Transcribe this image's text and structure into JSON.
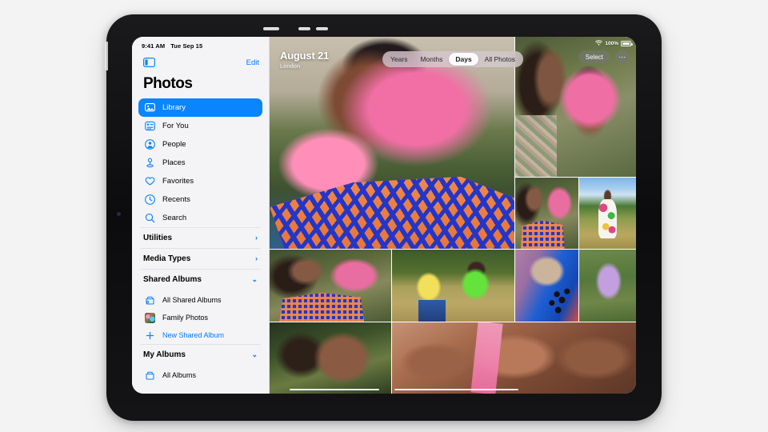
{
  "device": {
    "name": "iPad Pro",
    "frame_color": "#111113"
  },
  "status_bar": {
    "time": "9:41 AM",
    "date": "Tue Sep 15",
    "wifi_icon": "wifi-icon",
    "battery_percent": "100%",
    "battery_icon": "battery-full-icon"
  },
  "sidebar": {
    "toggle_icon": "sidebar-toggle-icon",
    "edit_label": "Edit",
    "title": "Photos",
    "nav_items": [
      {
        "label": "Library",
        "icon": "photos-library-icon",
        "selected": true
      },
      {
        "label": "For You",
        "icon": "for-you-icon",
        "selected": false
      },
      {
        "label": "People",
        "icon": "person-circle-icon",
        "selected": false
      },
      {
        "label": "Places",
        "icon": "map-pin-icon",
        "selected": false
      },
      {
        "label": "Favorites",
        "icon": "heart-icon",
        "selected": false
      },
      {
        "label": "Recents",
        "icon": "clock-icon",
        "selected": false
      },
      {
        "label": "Search",
        "icon": "search-icon",
        "selected": false
      }
    ],
    "sections": [
      {
        "label": "Utilities",
        "chevron": "chevron-right-icon",
        "expanded": false,
        "items": []
      },
      {
        "label": "Media Types",
        "chevron": "chevron-right-icon",
        "expanded": false,
        "items": []
      },
      {
        "label": "Shared Albums",
        "chevron": "chevron-down-icon",
        "expanded": true,
        "items": [
          {
            "label": "All Shared Albums",
            "icon": "shared-album-icon",
            "accent": false
          },
          {
            "label": "Family Photos",
            "icon": "album-thumbnail",
            "accent": false
          },
          {
            "label": "New Shared Album",
            "icon": "plus-icon",
            "accent": true
          }
        ]
      },
      {
        "label": "My Albums",
        "chevron": "chevron-down-icon",
        "expanded": true,
        "items": [
          {
            "label": "All Albums",
            "icon": "album-icon",
            "accent": false
          }
        ]
      }
    ],
    "selected_color": "#0a84ff",
    "accent_color": "#007aff"
  },
  "photo_pane": {
    "day_title": "August 21",
    "day_location": "London",
    "segmented_control": {
      "options": [
        "Years",
        "Months",
        "Days",
        "All Photos"
      ],
      "selected": "Days"
    },
    "select_label": "Select",
    "more_icon": "ellipsis-icon",
    "photos": [
      {
        "id": "hero",
        "alt": "woman in pink hijab and blue orange dress"
      },
      {
        "id": "two",
        "alt": "two women, pink hijab"
      },
      {
        "id": "pair",
        "alt": "two women embracing in field"
      },
      {
        "id": "field2",
        "alt": "woman in floral dress in meadow"
      },
      {
        "id": "pair2",
        "alt": "mother and daughter cheek to cheek"
      },
      {
        "id": "field",
        "alt": "two girls sitting in a field"
      },
      {
        "id": "berry",
        "alt": "blackberries on blue cloth"
      },
      {
        "id": "purple",
        "alt": "woman in lilac hijab"
      },
      {
        "id": "smile",
        "alt": "smiling woman with curly hair"
      },
      {
        "id": "kiss",
        "alt": "three women kissing cheeks"
      }
    ]
  }
}
